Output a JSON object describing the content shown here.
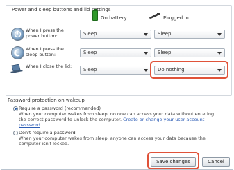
{
  "section_title": "Power and sleep buttons and lid settings",
  "columns": {
    "battery": "On battery",
    "plugged": "Plugged in"
  },
  "rows": [
    {
      "label": "When I press the power button:",
      "battery": "Sleep",
      "plugged": "Sleep"
    },
    {
      "label": "When I press the sleep button:",
      "battery": "Sleep",
      "plugged": "Sleep"
    },
    {
      "label": "When I close the lid:",
      "battery": "Sleep",
      "plugged": "Do nothing"
    }
  ],
  "password": {
    "heading": "Password protection on wakeup",
    "require_label": "Require a password (recommended)",
    "require_desc_text": "When your computer wakes from sleep, no one can access your data without entering the correct password to unlock the computer.",
    "require_link": "Create or change your user account password",
    "norequire_label": "Don't require a password",
    "norequire_desc": "When your computer wakes from sleep, anyone can access your data because the computer isn't locked."
  },
  "buttons": {
    "save": "Save changes",
    "cancel": "Cancel"
  },
  "colors": {
    "highlight": "#e0533a",
    "link": "#2d5db5"
  },
  "icons": {
    "battery": "battery-icon",
    "plug": "plug-icon",
    "power": "power-button-icon",
    "sleep": "sleep-button-icon",
    "lid": "laptop-lid-icon"
  }
}
